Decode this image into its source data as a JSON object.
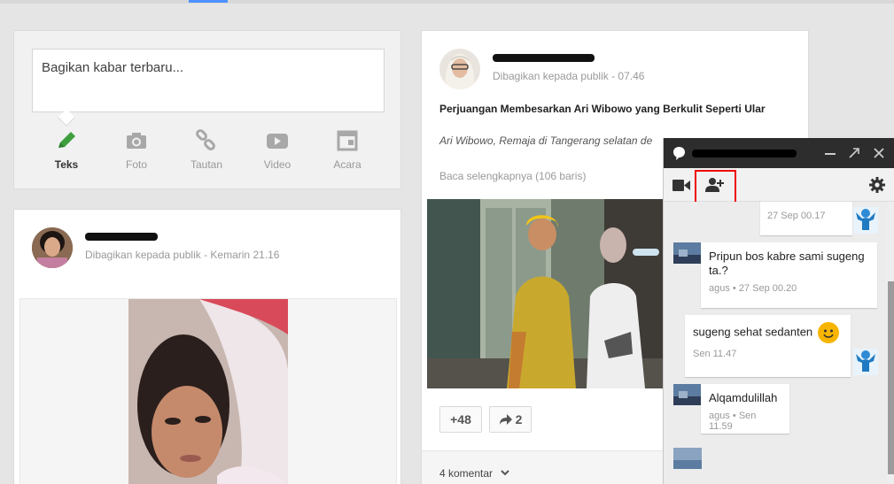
{
  "share": {
    "placeholder": "Bagikan kabar terbaru...",
    "options": [
      {
        "label": "Teks",
        "icon": "pencil-icon"
      },
      {
        "label": "Foto",
        "icon": "camera-icon"
      },
      {
        "label": "Tautan",
        "icon": "link-icon"
      },
      {
        "label": "Video",
        "icon": "video-icon"
      },
      {
        "label": "Acara",
        "icon": "calendar-icon"
      }
    ]
  },
  "post_left": {
    "meta": "Dibagikan kepada publik  -  Kemarin 21.16"
  },
  "post_right": {
    "meta": "Dibagikan kepada publik  -  07.46",
    "title": "Perjuangan Membesarkan Ari Wibowo yang Berkulit Seperti Ular",
    "excerpt": "Ari Wibowo, Remaja di Tangerang selatan de",
    "read_more": "Baca selengkapnya (106 baris)",
    "plus_count": "+48",
    "share_count": "2",
    "comments": "4 komentar"
  },
  "chat": {
    "messages": [
      {
        "time": "27 Sep 00.17"
      },
      {
        "text": "Pripun bos kabre sami sugeng ta.?",
        "time": "agus • 27 Sep 00.20"
      },
      {
        "text": "sugeng sehat sedanten",
        "time": "Sen 11.47"
      },
      {
        "text": "Alqamdulillah",
        "time": "agus • Sen 11.59"
      }
    ]
  },
  "colors": {
    "accent": "#4d90fe",
    "active_icon": "#3f9f3f",
    "highlight": "#ee0000",
    "chat_header": "#2d2d2d"
  }
}
